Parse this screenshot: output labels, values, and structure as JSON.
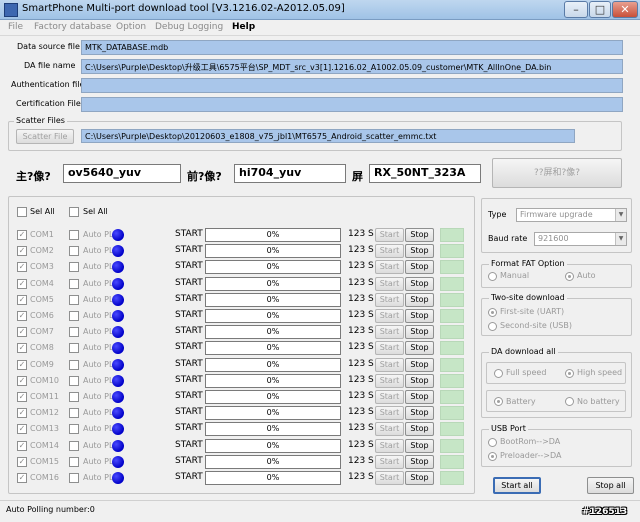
{
  "window": {
    "title": "SmartPhone Multi-port download tool [V3.1216.02-A2012.05.09]"
  },
  "menu": [
    "File",
    "Factory database",
    "Option",
    "Debug Logging",
    "Help"
  ],
  "files": {
    "data_source": {
      "label": "Data source file",
      "value": "MTK_DATABASE.mdb"
    },
    "da": {
      "label": "DA file name",
      "value": "C:\\Users\\Purple\\Desktop\\升级工具\\6575平台\\SP_MDT_src_v3[1].1216.02_A1002.05.09_customer\\MTK_AllInOne_DA.bin"
    },
    "auth": {
      "label": "Authentication file",
      "value": ""
    },
    "cert": {
      "label": "Certification File",
      "value": ""
    }
  },
  "scatter": {
    "group_label": "Scatter Files",
    "button": "Scatter File",
    "value": "C:\\Users\\Purple\\Desktop\\20120603_e1808_v75_jbl1\\MT6575_Android_scatter_emmc.txt"
  },
  "camera": {
    "main_label": "主?像?",
    "main_value": "ov5640_yuv",
    "front_label": "前?像?",
    "front_value": "hi704_yuv",
    "screen_label": "屏",
    "screen_value": "RX_50NT_323A",
    "action_button": "??屏和?像?"
  },
  "sel_all": [
    "Sel All",
    "Sel All"
  ],
  "ports": [
    {
      "com": "COM1",
      "auto": "Auto PL",
      "start": "START",
      "progress": "0%",
      "speed": "123 S"
    },
    {
      "com": "COM2",
      "auto": "Auto PL",
      "start": "START",
      "progress": "0%",
      "speed": "123 S"
    },
    {
      "com": "COM3",
      "auto": "Auto PL",
      "start": "START",
      "progress": "0%",
      "speed": "123 S"
    },
    {
      "com": "COM4",
      "auto": "Auto PL",
      "start": "START",
      "progress": "0%",
      "speed": "123 S"
    },
    {
      "com": "COM5",
      "auto": "Auto PL",
      "start": "START",
      "progress": "0%",
      "speed": "123 S"
    },
    {
      "com": "COM6",
      "auto": "Auto PL",
      "start": "START",
      "progress": "0%",
      "speed": "123 S"
    },
    {
      "com": "COM7",
      "auto": "Auto PL",
      "start": "START",
      "progress": "0%",
      "speed": "123 S"
    },
    {
      "com": "COM8",
      "auto": "Auto PL",
      "start": "START",
      "progress": "0%",
      "speed": "123 S"
    },
    {
      "com": "COM9",
      "auto": "Auto PL",
      "start": "START",
      "progress": "0%",
      "speed": "123 S"
    },
    {
      "com": "COM10",
      "auto": "Auto PL",
      "start": "START",
      "progress": "0%",
      "speed": "123 S"
    },
    {
      "com": "COM11",
      "auto": "Auto PL",
      "start": "START",
      "progress": "0%",
      "speed": "123 S"
    },
    {
      "com": "COM12",
      "auto": "Auto PL",
      "start": "START",
      "progress": "0%",
      "speed": "123 S"
    },
    {
      "com": "COM13",
      "auto": "Auto PL",
      "start": "START",
      "progress": "0%",
      "speed": "123 S"
    },
    {
      "com": "COM14",
      "auto": "Auto PL",
      "start": "START",
      "progress": "0%",
      "speed": "123 S"
    },
    {
      "com": "COM15",
      "auto": "Auto PL",
      "start": "START",
      "progress": "0%",
      "speed": "123 S"
    },
    {
      "com": "COM16",
      "auto": "Auto PL",
      "start": "START",
      "progress": "0%",
      "speed": "123 S"
    }
  ],
  "row_buttons": {
    "start": "Start",
    "stop": "Stop"
  },
  "settings": {
    "type_label": "Type",
    "type_value": "Firmware upgrade",
    "baud_label": "Baud rate",
    "baud_value": "921600",
    "format_fat": {
      "label": "Format FAT Option",
      "manual": "Manual",
      "auto": "Auto"
    },
    "two_site": {
      "label": "Two-site download",
      "first": "First-site (UART)",
      "second": "Second-site (USB)"
    },
    "da_all": {
      "label": "DA download all",
      "full": "Full speed",
      "high": "High speed",
      "battery": "Battery",
      "no_battery": "No battery"
    },
    "usb": {
      "label": "USB Port",
      "bootrom": "BootRom-->DA",
      "preloader": "Preloader-->DA"
    }
  },
  "actions": {
    "start_all": "Start all",
    "stop_all": "Stop all"
  },
  "statusbar": {
    "text": "Auto Polling number:0"
  },
  "watermark": "#126513",
  "colors": {
    "field_bg": "#a9c6ea",
    "dot": "#0000c8",
    "status_green": "#c6e6c6"
  }
}
